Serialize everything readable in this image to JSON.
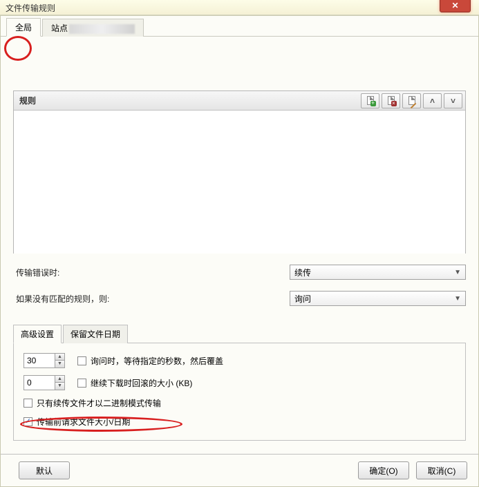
{
  "window": {
    "title": "文件传输规则",
    "close": "✕"
  },
  "tabs": {
    "global": "全局",
    "site": "站点"
  },
  "rules": {
    "header": "规则",
    "tools": {
      "add": "add",
      "delete": "delete",
      "edit": "edit",
      "up": "˄",
      "down": "˅"
    }
  },
  "options": {
    "on_error_label": "传输错误时:",
    "on_error_value": "续传",
    "no_match_label": "如果没有匹配的规则，则:",
    "no_match_value": "询问"
  },
  "inner_tabs": {
    "advanced": "高级设置",
    "preserve": "保留文件日期"
  },
  "advanced": {
    "seconds_value": "30",
    "seconds_label": "询问时，等待指定的秒数，然后覆盖",
    "rollback_value": "0",
    "rollback_label": "继续下载时回滚的大小 (KB)",
    "binary_label": "只有续传文件才以二进制模式传输",
    "request_label": "传输前请求文件大小/日期",
    "seconds_checked": false,
    "rollback_checked": false,
    "binary_checked": false,
    "request_checked": true
  },
  "footer": {
    "default": "默认",
    "ok": "确定(O)",
    "cancel": "取消(C)"
  }
}
